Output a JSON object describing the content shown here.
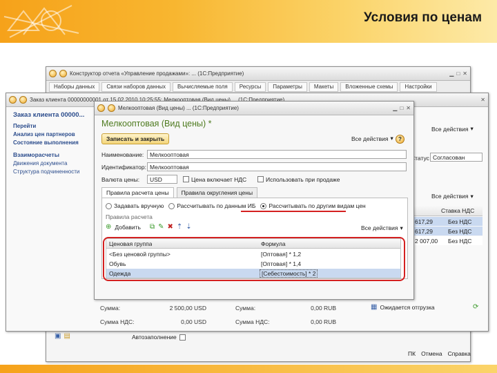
{
  "slide": {
    "title": "Условия по ценам",
    "colors": {
      "band_start": "#f6a21a",
      "band_end": "#fdeaa8",
      "highlight": "#d42020",
      "form_title": "#4d7a1e",
      "link": "#2b4c8c"
    }
  },
  "back_window": {
    "title": "Конструктор отчета «Управление продажами»: ... (1С:Предприятие)",
    "tabs": [
      "Наборы данных",
      "Связи наборов данных",
      "Вычисляемые поля",
      "Ресурсы",
      "Параметры",
      "Макеты",
      "Вложенные схемы",
      "Настройки"
    ],
    "footer": {
      "checkbox_label": "Автозаполнение",
      "links": [
        "ПК",
        "Отмена",
        "Справка"
      ]
    }
  },
  "mid_window": {
    "title": "Заказ клиента 00000000001 от 15.02.2010 10:25:55: Мелкооптовая (Вид цены) ... (1С:Предприятие)",
    "right_actions": "Все действия",
    "status_label": "Статус",
    "status_value": "Согласован",
    "table_header": "Ставка НДС",
    "rows": [
      {
        "amount": "617,29",
        "vat": "Без НДС"
      },
      {
        "amount": "617,29",
        "vat": "Без НДС"
      },
      {
        "amount": "2 007,00",
        "vat": "Без НДС"
      }
    ]
  },
  "nav": {
    "title": "Заказ клиента 00000...",
    "goto": "Перейти",
    "links": [
      "Анализ цен партнеров",
      "Состояние выполнения"
    ],
    "section": "Взаиморасчеты",
    "section_links": [
      "Движения документа",
      "Структура подчиненности"
    ]
  },
  "form_window": {
    "title": "Мелкооптовая (Вид цены) ... (1С:Предприятие)",
    "heading": "Мелкооптовая (Вид цены) *",
    "save_close": "Записать и закрыть",
    "all_actions": "Все действия",
    "help": "?",
    "fields": {
      "name_label": "Наименование:",
      "name_value": "Мелкооптовая",
      "id_label": "Идентификатор:",
      "id_value": "Мелкооптовая",
      "currency_label": "Валюта цены:",
      "currency_value": "USD",
      "vat_label": "Цена включает НДС",
      "sale_label": "Использовать при продаже"
    },
    "inner_tabs": [
      "Правила расчета цены",
      "Правила округления цены"
    ],
    "radios": [
      "Задавать вручную",
      "Рассчитывать по данным ИБ",
      "Рассчитывать по другим видам цен"
    ],
    "rule_caption": "Правила расчета",
    "add_btn": "Добавить",
    "table_actions": "Все действия",
    "table": {
      "headers": [
        "Ценовая группа",
        "Формула"
      ],
      "rows": [
        {
          "group": "<Без ценовой группы>",
          "formula": "[Оптовая] * 1,2"
        },
        {
          "group": "Обувь",
          "formula": "[Оптовая] * 1,4"
        },
        {
          "group": "Одежда",
          "formula": "[Себестоимость] * 2"
        }
      ]
    }
  },
  "summary": {
    "sum_label": "Сумма:",
    "sum_value": "2 500,00 USD",
    "vat_sum_label": "Сумма НДС:",
    "vat_sum_value": "0,00 USD",
    "sum2_label": "Сумма:",
    "sum2_value": "0,00 RUB",
    "vat2_label": "Сумма НДС:",
    "vat2_value": "0,00 RUB",
    "shipping": "Ожидается отгрузка"
  },
  "icons": [
    "search-icon",
    "add-icon",
    "edit-icon",
    "delete-icon",
    "copy-icon",
    "check-icon",
    "save-icon",
    "folder-icon",
    "close-icon"
  ]
}
